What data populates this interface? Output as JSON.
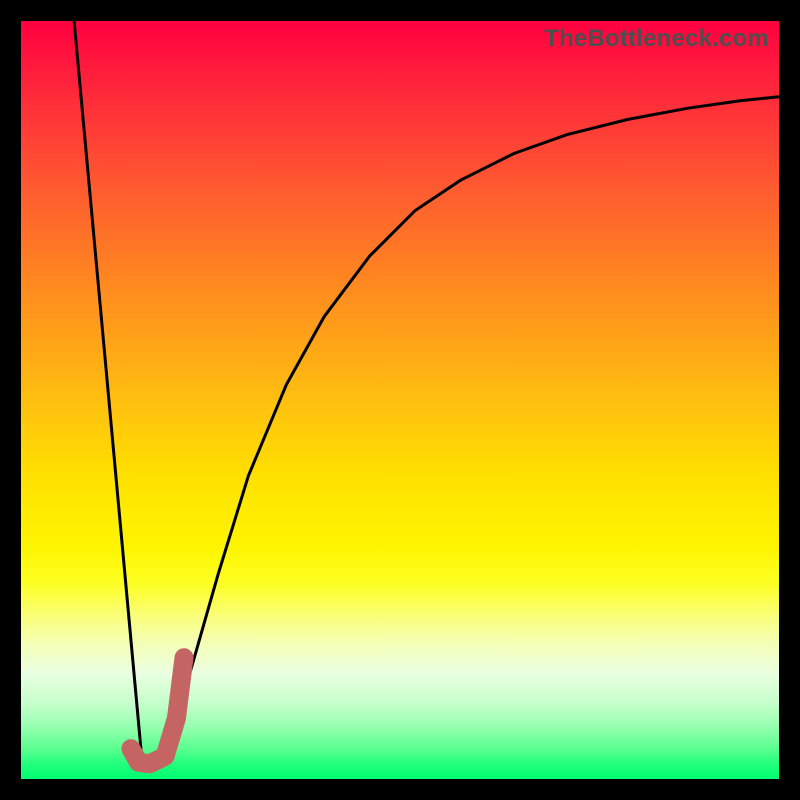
{
  "watermark": "TheBottleneck.com",
  "chart_data": {
    "type": "line",
    "title": "",
    "xlabel": "",
    "ylabel": "",
    "xlim": [
      0,
      100
    ],
    "ylim": [
      0,
      100
    ],
    "grid": false,
    "series": [
      {
        "name": "left-line",
        "color": "#000000",
        "stroke_width": 3,
        "x": [
          7,
          16
        ],
        "values": [
          100,
          2
        ]
      },
      {
        "name": "right-curve",
        "color": "#000000",
        "stroke_width": 3,
        "x": [
          19,
          22,
          26,
          30,
          35,
          40,
          46,
          52,
          58,
          65,
          72,
          80,
          88,
          95,
          100
        ],
        "values": [
          3,
          13,
          27,
          40,
          52,
          61,
          69,
          75,
          79,
          82.5,
          85,
          87,
          88.5,
          89.5,
          90
        ]
      },
      {
        "name": "hook-accent",
        "color": "#c46563",
        "stroke_width": 19,
        "x": [
          14.5,
          15.5,
          17,
          19,
          20.5,
          21.5
        ],
        "values": [
          4,
          2.2,
          2,
          3,
          8,
          16
        ]
      }
    ],
    "gradient_stops": [
      {
        "pos": 0.0,
        "color": "#ff0040"
      },
      {
        "pos": 0.5,
        "color": "#ffbf10"
      },
      {
        "pos": 0.78,
        "color": "#faff70"
      },
      {
        "pos": 1.0,
        "color": "#00ff70"
      }
    ]
  }
}
